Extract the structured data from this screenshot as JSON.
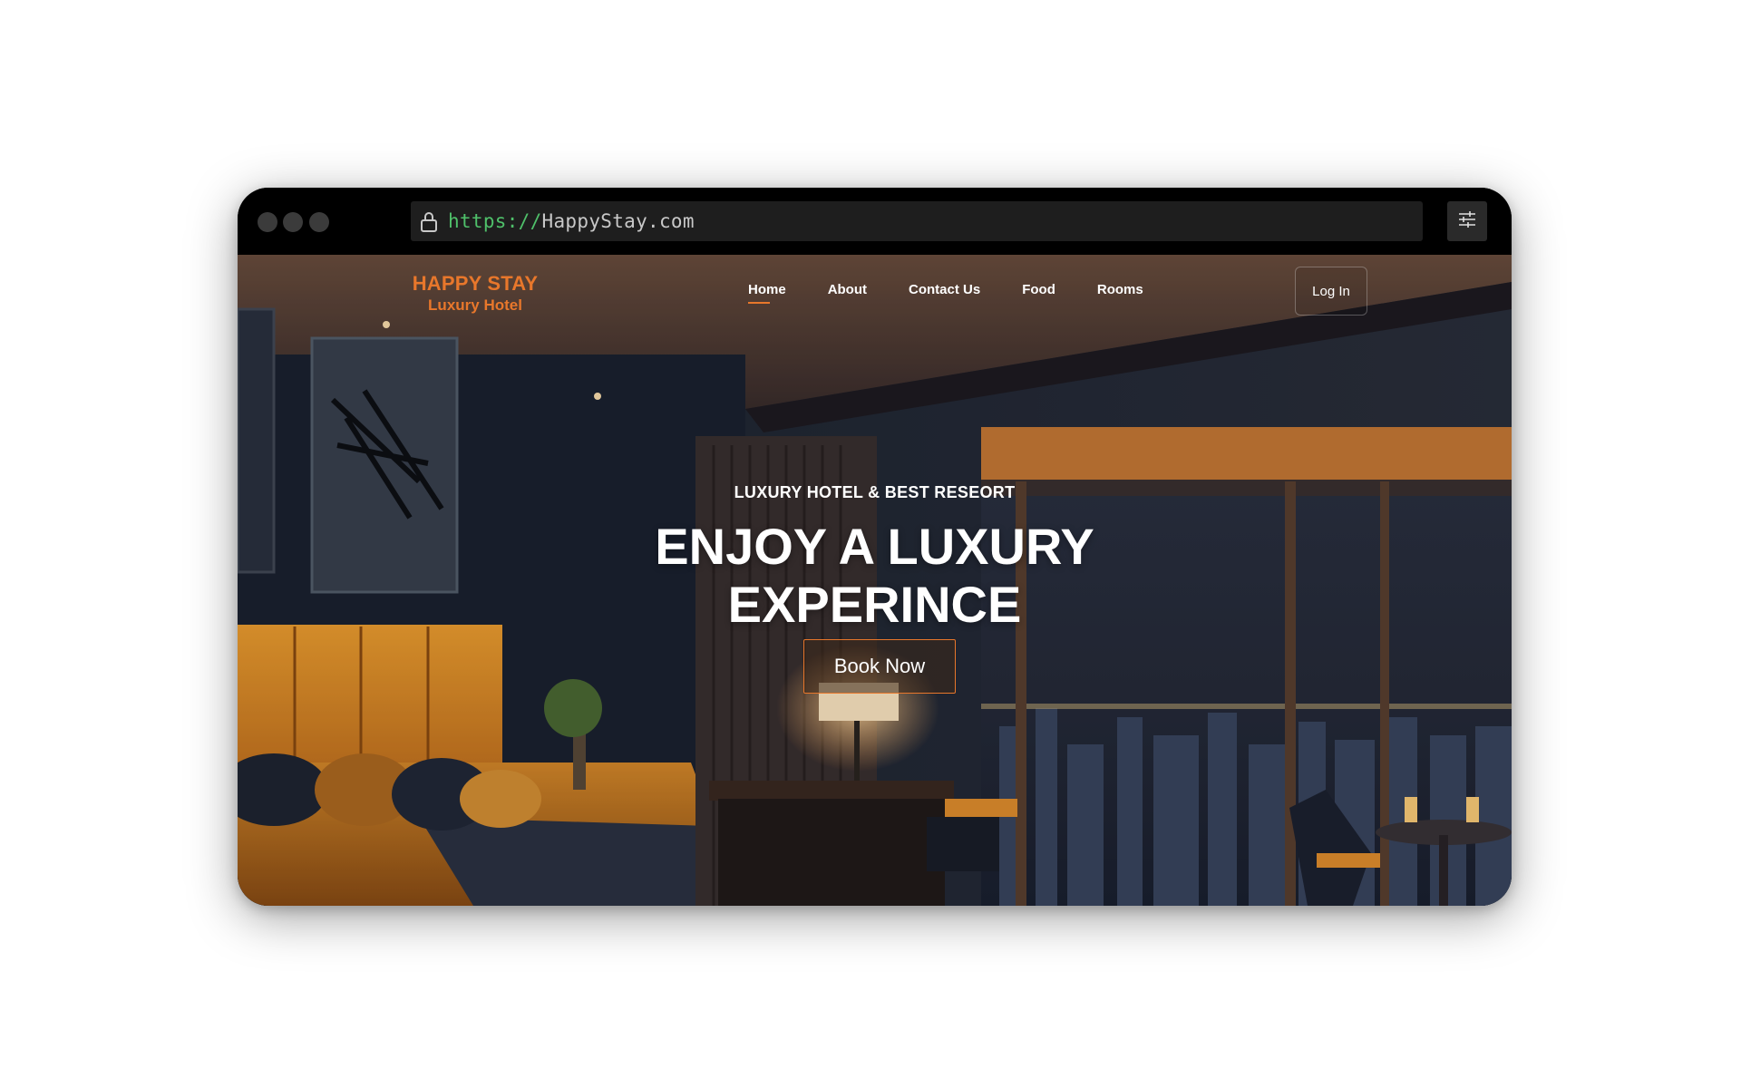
{
  "browser": {
    "url_scheme": "https://",
    "url_host": "HappyStay.com"
  },
  "brand": {
    "name": "HAPPY STAY",
    "subtitle": "Luxury Hotel"
  },
  "nav": {
    "items": [
      {
        "label": "Home",
        "active": true
      },
      {
        "label": "About",
        "active": false
      },
      {
        "label": "Contact Us",
        "active": false
      },
      {
        "label": "Food",
        "active": false
      },
      {
        "label": "Rooms",
        "active": false
      }
    ],
    "login_label": "Log In"
  },
  "hero": {
    "eyebrow": "LUXURY HOTEL & BEST RESEORT",
    "headline_line1": "ENJOY A LUXURY",
    "headline_line2": "EXPERINCE",
    "cta_label": "Book Now"
  },
  "colors": {
    "accent": "#e8772b",
    "url_scheme": "#4fc06a",
    "chrome": "#000000",
    "urlbar": "#1e1e1e"
  }
}
